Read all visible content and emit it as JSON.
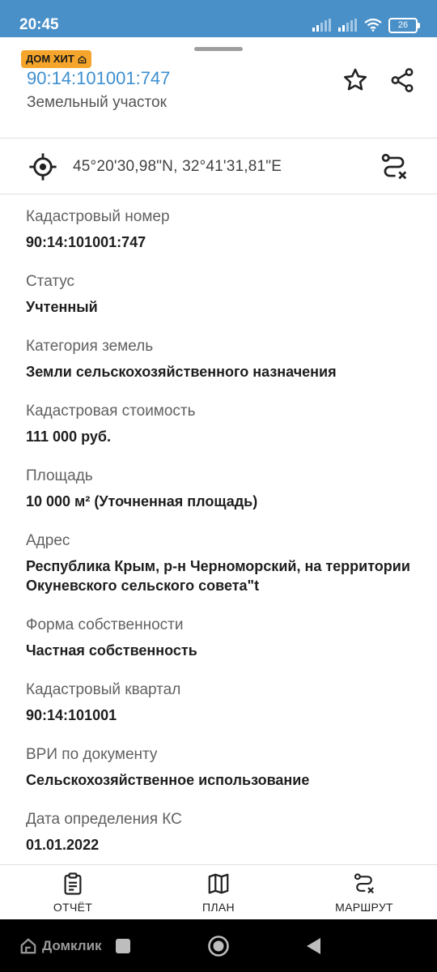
{
  "status_bar": {
    "time": "20:45",
    "battery": "26",
    "icons": [
      "signal-icon",
      "signal-icon",
      "wifi-icon",
      "battery-icon"
    ]
  },
  "header": {
    "badge": "ДОМ ХИТ",
    "cadastral_link": "90:14:101001:747",
    "subtitle": "Земельный участок",
    "icons": [
      "star-icon",
      "share-icon"
    ]
  },
  "coords": {
    "text": "45°20'30,98\"N, 32°41'31,81\"E",
    "icons": [
      "crosshair-icon",
      "route-clear-icon"
    ]
  },
  "fields": [
    {
      "label": "Кадастровый номер",
      "value": "90:14:101001:747"
    },
    {
      "label": "Статус",
      "value": "Учтенный"
    },
    {
      "label": "Категория земель",
      "value": "Земли сельскохозяйственного назначения"
    },
    {
      "label": "Кадастровая стоимость",
      "value": "111 000 руб."
    },
    {
      "label": "Площадь",
      "value": "10 000 м² (Уточненная площадь)"
    },
    {
      "label": "Адрес",
      "value": "Республика Крым, р-н Черноморский, на территории Окуневского сельского совета\"t"
    },
    {
      "label": "Форма собственности",
      "value": "Частная собственность"
    },
    {
      "label": "Кадастровый квартал",
      "value": "90:14:101001"
    },
    {
      "label": "ВРИ по документу",
      "value": "Сельскохозяйственное использование"
    },
    {
      "label": "Дата определения КС",
      "value": "01.01.2022"
    }
  ],
  "actions": {
    "report": "ОТЧЁТ",
    "plan": "ПЛАН",
    "route": "МАРШРУТ"
  },
  "navbar": {
    "brand": "Домклик"
  },
  "colors": {
    "status_bar": "#4a90c8",
    "badge": "#f5a52b",
    "link": "#3d8fd0"
  }
}
